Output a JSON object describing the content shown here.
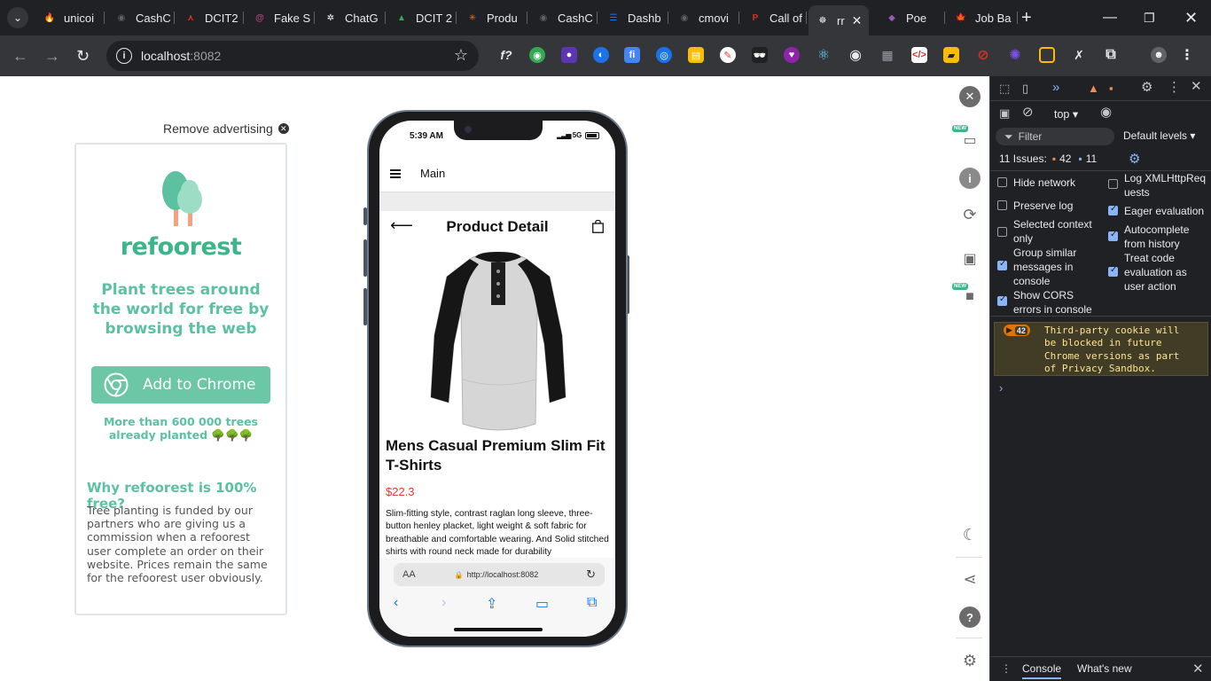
{
  "browser": {
    "tabs": [
      {
        "title": "unicoi",
        "color": "#f4511e",
        "glyph": "🔥"
      },
      {
        "title": "CashC",
        "color": "#5f6368",
        "glyph": "◉"
      },
      {
        "title": "DCIT2",
        "color": "#d93025",
        "glyph": "⋏"
      },
      {
        "title": "Fake S",
        "color": "#b0457d",
        "glyph": "@"
      },
      {
        "title": "ChatG",
        "color": "#ffffff",
        "glyph": "✲"
      },
      {
        "title": "DCIT 2",
        "color": "#34a853",
        "glyph": "▲"
      },
      {
        "title": "Produ",
        "color": "#e8710a",
        "glyph": "✳"
      },
      {
        "title": "CashC",
        "color": "#5f6368",
        "glyph": "◉"
      },
      {
        "title": "Dashb",
        "color": "#1a73e8",
        "glyph": "☰"
      },
      {
        "title": "cmovi",
        "color": "#5f6368",
        "glyph": "◉"
      },
      {
        "title": "Call of",
        "color": "#d93025",
        "glyph": "P"
      },
      {
        "title": "rr",
        "color": "#e8eaed",
        "glyph": "☸"
      },
      {
        "title": "Poe",
        "color": "#9b59b6",
        "glyph": "◆"
      },
      {
        "title": "Job Ba",
        "color": "#d93025",
        "glyph": "🍁"
      }
    ],
    "address": {
      "host": "localhost",
      "port": ":8082"
    }
  },
  "ad": {
    "remove_label": "Remove advertising",
    "brand": "refoorest",
    "tagline": "Plant trees around the world for free by browsing the web",
    "button_label": "Add to Chrome",
    "trees_count": "More than 600 000 trees already planted 🌳🌳🌳",
    "why_title": "Why refoorest is 100% free?",
    "why_body": "Tree planting is funded by our partners who are giving us a commission when a refoorest user complete an order on their website. Prices remain the same for the refoorest user obviously."
  },
  "phone": {
    "time": "5:39 AM",
    "network": "5G",
    "app_title": "Main",
    "page_title": "Product Detail",
    "product_name": "Mens Casual Premium Slim Fit T-Shirts",
    "price": "$22.3",
    "description": "Slim-fitting style, contrast raglan long sleeve, three-button henley placket, light weight & soft fabric for breathable and comfortable wearing. And Solid stitched shirts with round neck made for durability",
    "safari": {
      "text_size": "AA",
      "url": "http://localhost:8082"
    }
  },
  "side_tools": {
    "new_badge": "NEW"
  },
  "devtools": {
    "context": "top",
    "filter_placeholder": "Filter",
    "levels": "Default levels ▾",
    "issues_label": "11 Issues:",
    "issues_warn": "42",
    "issues_info": "11",
    "settings": {
      "hide_network": {
        "label": "Hide network",
        "checked": false
      },
      "log_xhr": {
        "label": "Log XMLHttpRequests",
        "checked": false
      },
      "preserve_log": {
        "label": "Preserve log",
        "checked": false
      },
      "eager_eval": {
        "label": "Eager evaluation",
        "checked": true
      },
      "selected_context": {
        "label": "Selected context only",
        "checked": false
      },
      "autocomplete": {
        "label": "Autocomplete from history",
        "checked": true
      },
      "group_similar": {
        "label": "Group similar messages in console",
        "checked": true
      },
      "treat_code": {
        "label": "Treat code evaluation as user action",
        "checked": true
      },
      "show_cors": {
        "label": "Show CORS errors in console",
        "checked": true
      }
    },
    "message_count": "42",
    "message": "Third-party cookie will be blocked in future Chrome versions as part of Privacy Sandbox.",
    "bottom_tabs": {
      "console": "Console",
      "whats_new": "What's new"
    }
  }
}
